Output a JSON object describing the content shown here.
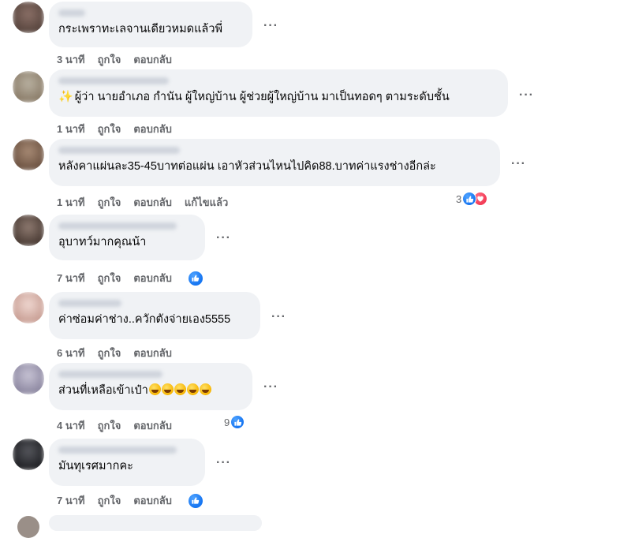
{
  "ui": {
    "more_glyph": "···",
    "like_color": "#1877f2",
    "love_color": "#f33e58"
  },
  "comments": [
    {
      "text": "กระเพราทะเลจานเดียวหมดแล้วพี่",
      "time": "3 นาที",
      "like_label": "ถูกใจ",
      "reply_label": "ตอบกลับ"
    },
    {
      "prefix_icon": "sparkles-icon",
      "prefix_glyph": "✨",
      "text": "ผู้ว่า นายอำเภอ กำนัน ผู้ใหญ่บ้าน ผู้ช่วยผู้ใหญ่บ้าน มาเป็นทอดๆ ตามระดับชั้น",
      "time": "1 นาที",
      "like_label": "ถูกใจ",
      "reply_label": "ตอบกลับ"
    },
    {
      "text": "หลังคาแผ่นละ35-45บาทต่อแผ่น เอาหัวส่วนไหนไปคิด88.บาทค่าแรงช่างอีกล่ะ",
      "time": "1 นาที",
      "like_label": "ถูกใจ",
      "reply_label": "ตอบกลับ",
      "edited_label": "แก้ไขแล้ว",
      "reaction_count": "3"
    },
    {
      "text": "อุบาทว์มากคุณน้า",
      "time": "7 นาที",
      "like_label": "ถูกใจ",
      "reply_label": "ตอบกลับ"
    },
    {
      "text": "ค่าซ่อมค่าช่าง..ควักตังจ่ายเอง5555",
      "time": "6 นาที",
      "like_label": "ถูกใจ",
      "reply_label": "ตอบกลับ"
    },
    {
      "text": "ส่วนที่เหลือเข้าเป๋า",
      "time": "4 นาที",
      "like_label": "ถูกใจ",
      "reply_label": "ตอบกลับ",
      "reaction_count": "9"
    },
    {
      "text": "มันทุเรศมากคะ",
      "time": "7 นาที",
      "like_label": "ถูกใจ",
      "reply_label": "ตอบกลับ"
    }
  ]
}
